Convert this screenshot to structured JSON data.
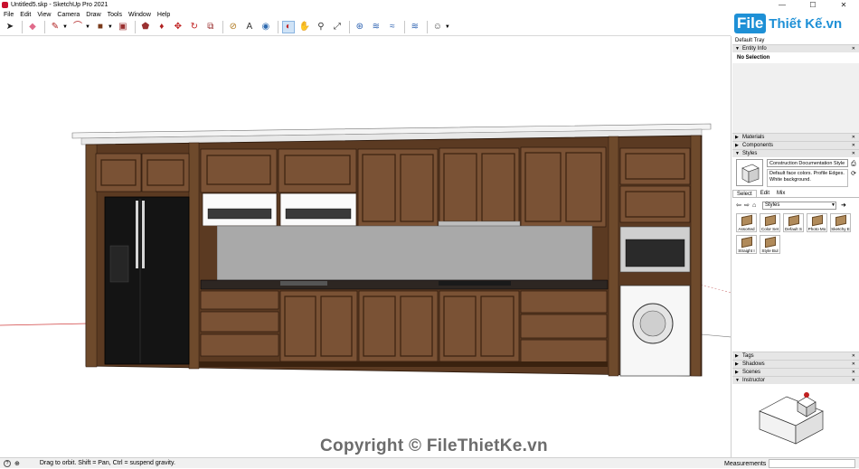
{
  "window": {
    "title": "Untitled5.skp - SketchUp Pro 2021",
    "minimize": "—",
    "maximize": "☐",
    "close": "✕"
  },
  "menu": [
    "File",
    "Edit",
    "View",
    "Camera",
    "Draw",
    "Tools",
    "Window",
    "Help"
  ],
  "logo": {
    "file": "File",
    "rest": "Thiết Kế.vn"
  },
  "tray": {
    "title": "Default Tray",
    "entity_info": {
      "header": "Entity Info",
      "selection": "No Selection"
    },
    "materials": "Materials",
    "components": "Components",
    "styles": {
      "header": "Styles",
      "current_name": "Construction Documentation Style",
      "description": "Default face colors. Profile Edges. White background.",
      "tabs": [
        "Select",
        "Edit",
        "Mix"
      ],
      "library": "Styles",
      "thumbnails": [
        "Assorted",
        "Color Set",
        "Default S",
        "Photo Mo",
        "Sketchy E",
        "Straight I",
        "Style Bul"
      ]
    },
    "tags": "Tags",
    "shadows": "Shadows",
    "scenes": "Scenes",
    "instructor": "Instructor"
  },
  "viewport": {
    "watermark": "Copyright © FileThietKe.vn"
  },
  "status": {
    "message": "Drag to orbit. Shift = Pan, Ctrl = suspend gravity.",
    "measurements_label": "Measurements"
  },
  "colors": {
    "wood_dark": "#4a2e1a",
    "wood_mid": "#7a5235",
    "wood_light": "#9b6e48",
    "fridge": "#141414",
    "backsplash": "#a9a9a9",
    "countertop": "#2d2622",
    "accent_blue": "#1e90d6"
  }
}
